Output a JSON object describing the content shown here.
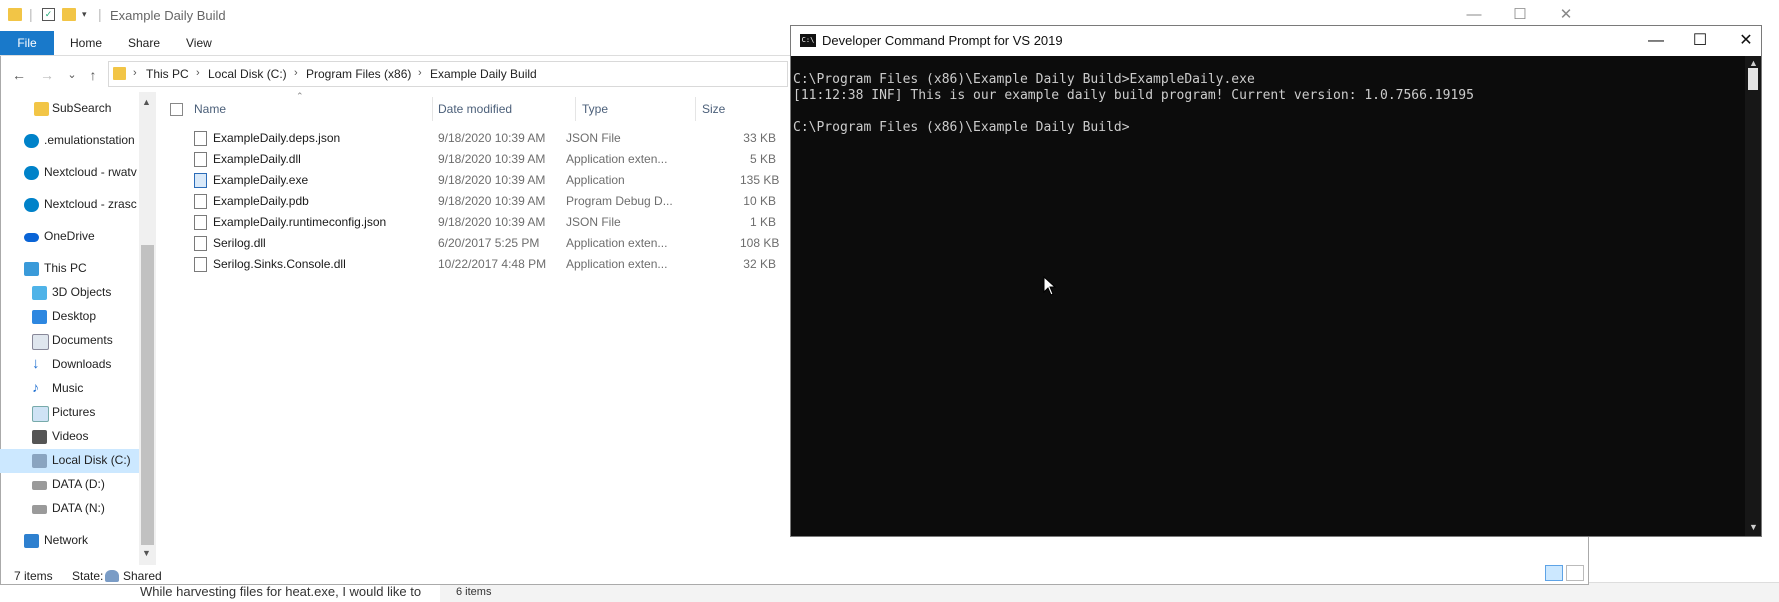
{
  "background": {
    "text": "While harvesting files for heat.exe, I would like to",
    "status": "6 items"
  },
  "explorer": {
    "title": "Example Daily Build",
    "window_controls": {
      "minimize": "—",
      "maximize": "☐",
      "close": "✕"
    },
    "ribbon_tabs": [
      "File",
      "Home",
      "Share",
      "View"
    ],
    "nav_buttons": {
      "back": "←",
      "forward": "→",
      "recent": "⌄",
      "up": "↑"
    },
    "breadcrumb": [
      "This PC",
      "Local Disk (C:)",
      "Program Files (x86)",
      "Example Daily Build"
    ],
    "breadcrumb_sep": "›",
    "sidebar": [
      {
        "label": "SubSearch",
        "icon": "folder-icon"
      },
      {
        "label": ".emulationstation",
        "icon": "nextcloud-icon"
      },
      {
        "label": "Nextcloud - rwatv",
        "icon": "nextcloud-icon"
      },
      {
        "label": "Nextcloud - zrasc",
        "icon": "nextcloud-icon"
      },
      {
        "label": "OneDrive",
        "icon": "cloud-icon"
      },
      {
        "label": "This PC",
        "icon": "computer-icon"
      },
      {
        "label": "3D Objects",
        "icon": "cube-icon"
      },
      {
        "label": "Desktop",
        "icon": "desktop-icon"
      },
      {
        "label": "Documents",
        "icon": "documents-icon"
      },
      {
        "label": "Downloads",
        "icon": "download-icon"
      },
      {
        "label": "Music",
        "icon": "music-icon"
      },
      {
        "label": "Pictures",
        "icon": "pictures-icon"
      },
      {
        "label": "Videos",
        "icon": "videos-icon"
      },
      {
        "label": "Local Disk (C:)",
        "icon": "drive-icon"
      },
      {
        "label": "DATA (D:)",
        "icon": "drive-icon"
      },
      {
        "label": "DATA (N:)",
        "icon": "drive-icon"
      },
      {
        "label": "Network",
        "icon": "network-icon"
      }
    ],
    "columns": {
      "name": "Name",
      "date": "Date modified",
      "type": "Type",
      "size": "Size"
    },
    "files": [
      {
        "name": "ExampleDaily.deps.json",
        "date": "9/18/2020 10:39 AM",
        "type": "JSON File",
        "size": "33 KB"
      },
      {
        "name": "ExampleDaily.dll",
        "date": "9/18/2020 10:39 AM",
        "type": "Application exten...",
        "size": "5 KB"
      },
      {
        "name": "ExampleDaily.exe",
        "date": "9/18/2020 10:39 AM",
        "type": "Application",
        "size": "135 KB"
      },
      {
        "name": "ExampleDaily.pdb",
        "date": "9/18/2020 10:39 AM",
        "type": "Program Debug D...",
        "size": "10 KB"
      },
      {
        "name": "ExampleDaily.runtimeconfig.json",
        "date": "9/18/2020 10:39 AM",
        "type": "JSON File",
        "size": "1 KB"
      },
      {
        "name": "Serilog.dll",
        "date": "6/20/2017 5:25 PM",
        "type": "Application exten...",
        "size": "108 KB"
      },
      {
        "name": "Serilog.Sinks.Console.dll",
        "date": "10/22/2017 4:48 PM",
        "type": "Application exten...",
        "size": "32 KB"
      }
    ],
    "status": {
      "count": "7 items",
      "state_label": "State:",
      "state_value": "Shared"
    }
  },
  "console": {
    "title": "Developer Command Prompt for VS 2019",
    "icon_text": "C:\\",
    "window_controls": {
      "minimize": "—",
      "maximize": "☐",
      "close": "✕"
    },
    "lines": [
      "C:\\Program Files (x86)\\Example Daily Build>ExampleDaily.exe",
      "[11:12:38 INF] This is our example daily build program! Current version: 1.0.7566.19195",
      "",
      "C:\\Program Files (x86)\\Example Daily Build>"
    ]
  },
  "colors": {
    "accent": "#1979ca",
    "selected": "#cce8ff",
    "console_bg": "#0c0c0c",
    "console_fg": "#cccccc"
  }
}
